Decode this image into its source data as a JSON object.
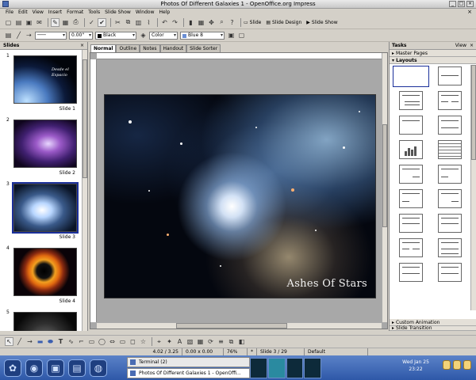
{
  "window": {
    "title": "Photos Of Different Galaxies 1 - OpenOffice.org Impress",
    "controls": [
      "_",
      "□",
      "×"
    ]
  },
  "menu": [
    "File",
    "Edit",
    "View",
    "Insert",
    "Format",
    "Tools",
    "Slide Show",
    "Window",
    "Help"
  ],
  "toolbar1": {
    "slide_label": "Slide",
    "slide_design_label": "Slide Design",
    "slide_show_label": "Slide Show"
  },
  "toolbar2": {
    "line_width": "0.00\"",
    "line_color": "Black",
    "area_style": "Color",
    "area_color": "Blue 8"
  },
  "slides_panel": {
    "title": "Slides",
    "slides": [
      {
        "num": "1",
        "label": "Slide 1",
        "thumb_text": "Desde el Espacio"
      },
      {
        "num": "2",
        "label": "Slide 2"
      },
      {
        "num": "3",
        "label": "Slide 3"
      },
      {
        "num": "4",
        "label": "Slide 4"
      },
      {
        "num": "5",
        "label": ""
      }
    ]
  },
  "view_tabs": [
    "Normal",
    "Outline",
    "Notes",
    "Handout",
    "Slide Sorter"
  ],
  "slide": {
    "title": "Ashes Of Stars"
  },
  "tasks_panel": {
    "title": "Tasks",
    "view_label": "View",
    "sections": {
      "master_pages": "Master Pages",
      "layouts": "Layouts",
      "custom_animation": "Custom Animation",
      "slide_transition": "Slide Transition"
    }
  },
  "status": {
    "position": "4.02 / 3.25",
    "size": "0.00 x 0.00",
    "zoom": "76%",
    "slide": "Slide 3 / 29",
    "layout": "Default"
  },
  "taskbar": {
    "tasks": [
      "Terminal (2)",
      "Photos Of Different Galaxies 1 - OpenOffi..."
    ],
    "clock_date": "Wed Jan 25",
    "clock_time": "23:22"
  }
}
